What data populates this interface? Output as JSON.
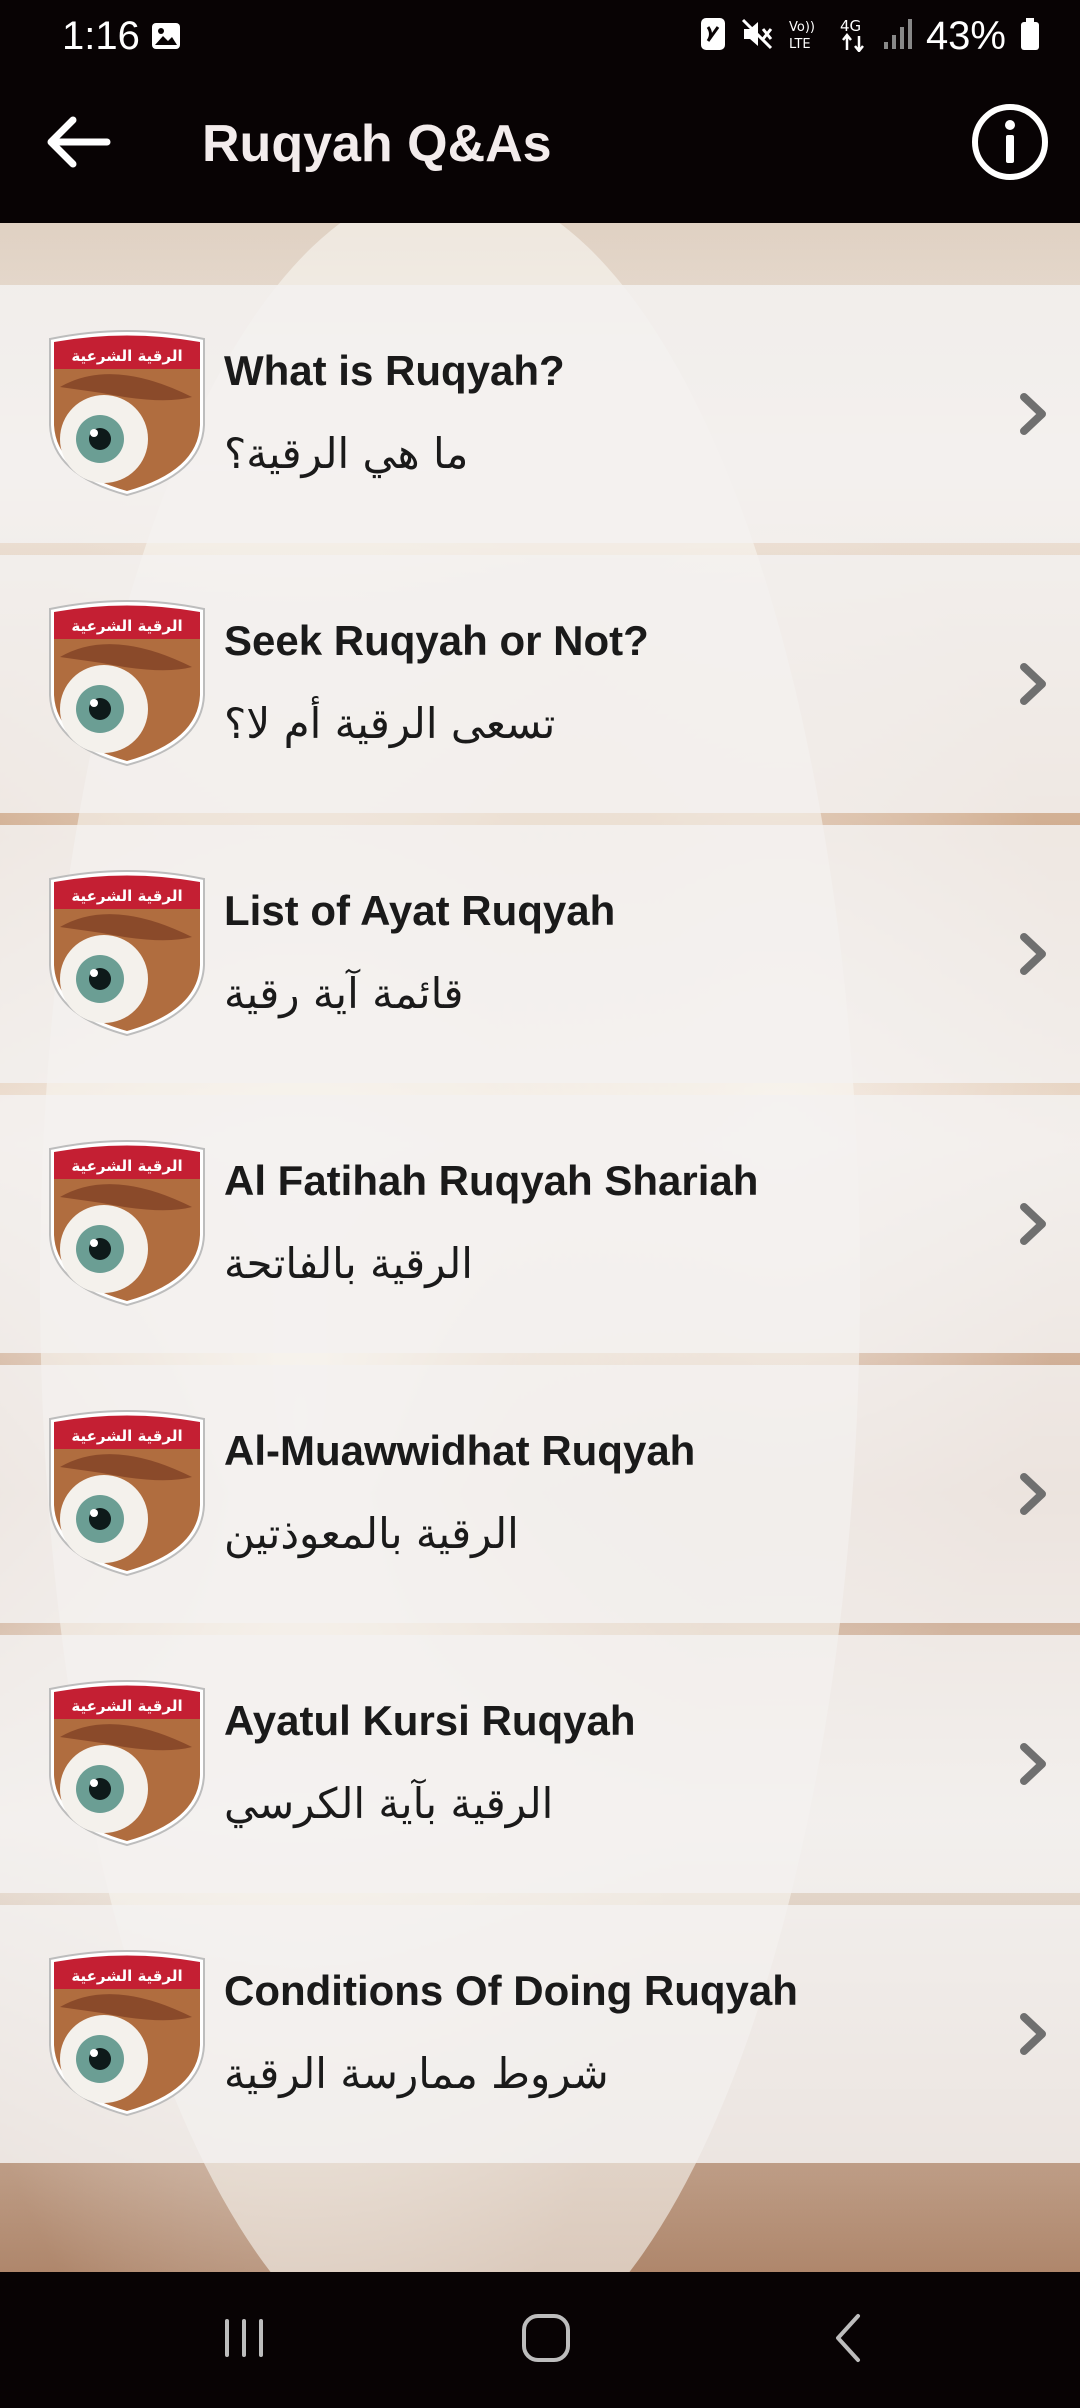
{
  "status_bar": {
    "time": "1:16",
    "battery_percent": "43%",
    "network_label": "4G",
    "volte_label": "Vo)) LTE",
    "icons": [
      "gallery-icon",
      "nfc-icon",
      "mute-icon",
      "volte-icon",
      "4g-icon",
      "signal-icon",
      "battery-icon"
    ]
  },
  "app_bar": {
    "title": "Ruqyah Q&As",
    "back_icon": "arrow-left-icon",
    "info_icon": "info-icon"
  },
  "thumb_caption": "الرقية الشرعية",
  "items": [
    {
      "title_en": "What is Ruqyah?",
      "title_ar": "ما هي الرقية؟"
    },
    {
      "title_en": "Seek Ruqyah or Not?",
      "title_ar": "تسعى الرقية أم لا؟"
    },
    {
      "title_en": "List of Ayat Ruqyah",
      "title_ar": "قائمة آية رقية"
    },
    {
      "title_en": "Al Fatihah Ruqyah Shariah",
      "title_ar": "الرقية بالفاتحة"
    },
    {
      "title_en": "Al-Muawwidhat Ruqyah",
      "title_ar": "الرقية بالمعوذتين"
    },
    {
      "title_en": "Ayatul Kursi Ruqyah",
      "title_ar": "الرقية بآية الكرسي"
    },
    {
      "title_en": "Conditions Of Doing Ruqyah",
      "title_ar": "شروط ممارسة الرقية"
    }
  ],
  "colors": {
    "bar_background": "#080304",
    "item_background": "#f3f1f0",
    "text": "#1a1a1a",
    "chevron": "#6f6f6f",
    "badge_red": "#c41f33"
  },
  "nav_bar": {
    "recents_icon": "recents-icon",
    "home_icon": "home-icon",
    "back_icon": "back-chevron-icon"
  }
}
